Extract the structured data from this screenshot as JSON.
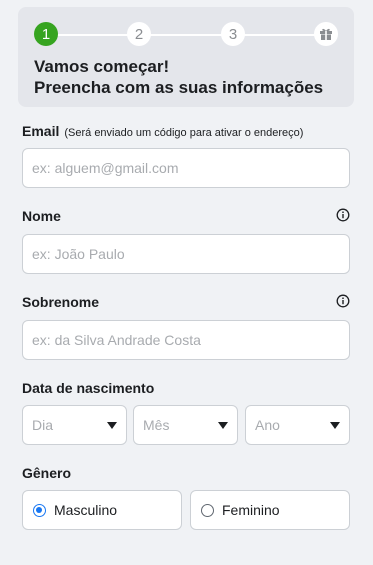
{
  "header": {
    "steps": [
      "1",
      "2",
      "3"
    ],
    "final_step_icon": "gift-icon",
    "active_step": 1,
    "title_line1": "Vamos começar!",
    "title_line2": "Preencha com as suas informações"
  },
  "email": {
    "label": "Email",
    "hint": "(Será enviado um código para ativar o endereço)",
    "placeholder": "ex: alguem@gmail.com",
    "value": ""
  },
  "nome": {
    "label": "Nome",
    "placeholder": "ex: João Paulo",
    "value": "",
    "info_icon": "info-icon"
  },
  "sobrenome": {
    "label": "Sobrenome",
    "placeholder": "ex: da Silva Andrade Costa",
    "value": "",
    "info_icon": "info-icon"
  },
  "birthdate": {
    "label": "Data de nascimento",
    "day": "Dia",
    "month": "Mês",
    "year": "Ano"
  },
  "gender": {
    "label": "Gênero",
    "options": [
      "Masculino",
      "Feminino"
    ],
    "selected": "Masculino"
  },
  "colors": {
    "active_step": "#36a420",
    "radio_accent": "#1877f2",
    "background": "#f0f2f5",
    "header_background": "#e4e6eb"
  }
}
